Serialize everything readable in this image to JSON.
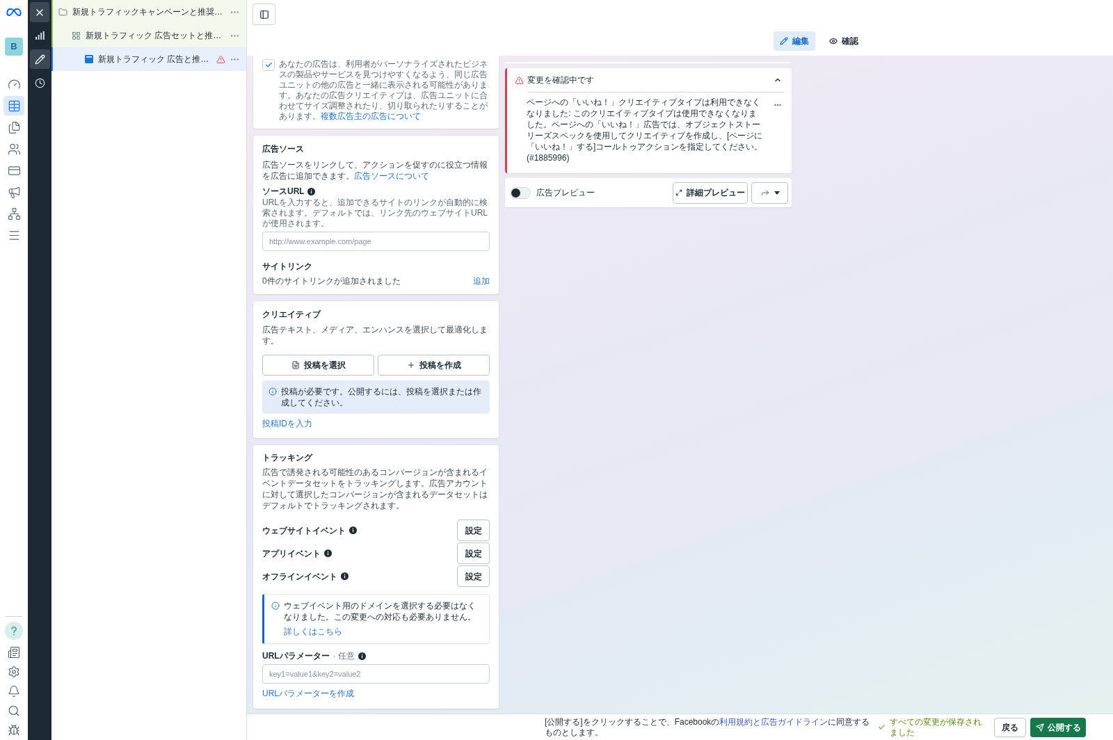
{
  "app_rail": {
    "avatar": "B",
    "nav_items": [
      {
        "selected": false
      },
      {
        "selected": true
      },
      {
        "selected": false
      },
      {
        "selected": false
      },
      {
        "selected": false
      },
      {
        "selected": false
      },
      {
        "selected": false
      },
      {
        "selected": false
      }
    ]
  },
  "tool_rail": {
    "items": [
      {
        "selected": false
      },
      {
        "selected": true
      },
      {
        "selected": false
      }
    ]
  },
  "tree": [
    {
      "kind": "campaign",
      "label": "新規トラフィックキャンペーンと推奨…",
      "selected": false,
      "warning": false,
      "children": [
        {
          "kind": "ad_set",
          "label": "新規トラフィック 広告セットと推…",
          "selected": false,
          "warning": false,
          "children": [
            {
              "kind": "ad",
              "label": "新規トラフィック 広告と推…",
              "selected": true,
              "warning": true
            }
          ]
        }
      ]
    }
  ],
  "mode_tabs": [
    {
      "label": "編集",
      "selected": true
    },
    {
      "label": "確認",
      "selected": false
    }
  ],
  "multi_advertiser": {
    "checked": true,
    "text": "あなたの広告は、利用者がパーソナライズされたビジネスの製品やサービスを見つけやすくなるよう、同じ広告ユニットの他の広告と一緒に表示される可能性があります。あなたの広告クリエイティブは、広告ユニットに合わせてサイズ調整されたり、切り取られたりすることがあります。",
    "link": "複数広告主の広告について"
  },
  "ad_source": {
    "title": "広告ソース",
    "description": "広告ソースをリンクして、アクションを促すのに役立つ情報を広告に追加できます。",
    "link": "広告ソースについて",
    "source_url": {
      "label": "ソースURL",
      "help": "URLを入力すると、追加できるサイトのリンクが自動的に検索されます。デフォルトでは、リンク先のウェブサイトURLが使用されます。",
      "placeholder": "http://www.example.com/page"
    },
    "site_links": {
      "title": "サイトリンク",
      "status": "0件のサイトリンクが追加されました",
      "add": "追加"
    }
  },
  "creative": {
    "title": "クリエイティブ",
    "description": "広告テキスト、メディア、エンハンスを選択して最適化します。",
    "buttons": [
      {
        "kind": "select",
        "label": "投稿を選択"
      },
      {
        "kind": "create",
        "label": "投稿を作成"
      }
    ],
    "notice": "投稿が必要です。公開するには、投稿を選択または作成してください。",
    "link": "投稿IDを入力"
  },
  "tracking": {
    "title": "トラッキング",
    "description": "広告で誘発される可能性のあるコンバージョンが含まれるイベントデータセットをトラッキングします。広告アカウントに対して選択したコンバージョンが含まれるデータセットはデフォルトでトラッキングされます。",
    "events": [
      {
        "label": "ウェブサイトイベント",
        "button": "設定"
      },
      {
        "label": "アプリイベント",
        "button": "設定"
      },
      {
        "label": "オフラインイベント",
        "button": "設定"
      }
    ],
    "notice": {
      "text": "ウェブイベント用のドメインを選択する必要はなくなりました。この変更への対応も必要ありません。",
      "link": "詳しくはこちら"
    },
    "url_parameters": {
      "label": "URLパラメーター",
      "optional": "· 任意",
      "placeholder": "key1=value1&key2=value2",
      "link": "URLパラメーターを作成"
    }
  },
  "review_alert": {
    "title": "変更を確認中です",
    "expanded": true,
    "message": "ページへの「いいね！」クリエイティブタイプは利用できなくなりました: このクリエイティブタイプは使用できなくなりました。ページへの「いいね！」広告では、オブジェクトストーリーズスペックを使用してクリエイティブを作成し、[ページに「いいね！」する]コールトゥアクションを指定してください。 (#1885996)"
  },
  "preview": {
    "label": "広告プレビュー",
    "on": false,
    "button": "詳細プレビュー"
  },
  "footer": {
    "terms_before": "[公開する]をクリックすることで、Facebookの",
    "terms_link": "利用規約と広告ガイドライン",
    "terms_after": "に同意するものとします。",
    "saved": "すべての変更が保存されました",
    "back": "戻る",
    "publish": "公開する"
  }
}
